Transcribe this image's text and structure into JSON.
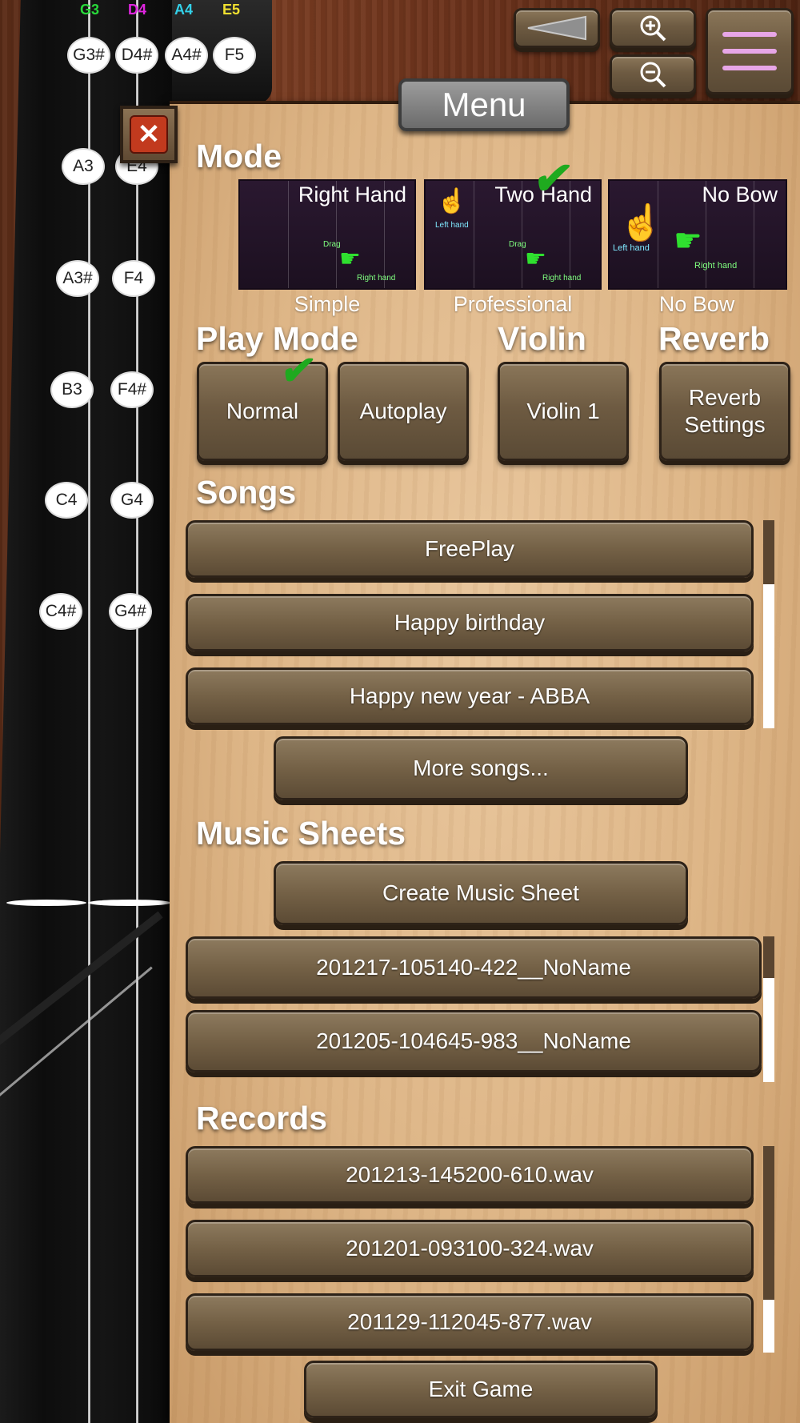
{
  "strings": [
    {
      "label": "G3",
      "color": "#28d83a"
    },
    {
      "label": "D4",
      "color": "#e024e0"
    },
    {
      "label": "A4",
      "color": "#33d0e8"
    },
    {
      "label": "E5",
      "color": "#f0e030"
    }
  ],
  "notes": {
    "row1": [
      "G3#",
      "D4#",
      "A4#",
      "F5"
    ],
    "col_left": [
      "A3",
      "A3#",
      "B3",
      "C4",
      "C4#"
    ],
    "col_right": [
      "E4",
      "F4",
      "F4#",
      "G4",
      "G4#"
    ]
  },
  "top_buttons": {
    "back_icon": "back-arrow-icon",
    "zoom_in_icon": "zoom-in-icon",
    "zoom_out_icon": "zoom-out-icon",
    "menu_icon": "hamburger-icon"
  },
  "menu": {
    "title": "Menu",
    "mode": {
      "heading": "Mode",
      "cards": [
        {
          "title": "Right Hand",
          "caption": "Simple",
          "selected": false
        },
        {
          "title": "Two Hand",
          "caption": "Professional",
          "selected": true
        },
        {
          "title": "No Bow",
          "caption": "No Bow",
          "selected": false
        }
      ],
      "drag_label": "Drag",
      "right_hand_label": "Right hand",
      "left_hand_label": "Left hand"
    },
    "play_mode": {
      "heading": "Play Mode",
      "options": [
        {
          "label": "Normal",
          "selected": true
        },
        {
          "label": "Autoplay",
          "selected": false
        }
      ]
    },
    "violin": {
      "heading": "Violin",
      "button": "Violin 1"
    },
    "reverb": {
      "heading": "Reverb",
      "button_line1": "Reverb",
      "button_line2": "Settings"
    },
    "songs": {
      "heading": "Songs",
      "items": [
        "FreePlay",
        "Happy birthday",
        "Happy new year - ABBA"
      ],
      "more": "More songs..."
    },
    "music_sheets": {
      "heading": "Music Sheets",
      "create": "Create Music Sheet",
      "items": [
        "201217-105140-422__NoName",
        "201205-104645-983__NoName"
      ]
    },
    "records": {
      "heading": "Records",
      "items": [
        "201213-145200-610.wav",
        "201201-093100-324.wav",
        "201129-112045-877.wav"
      ]
    },
    "exit": "Exit Game"
  }
}
